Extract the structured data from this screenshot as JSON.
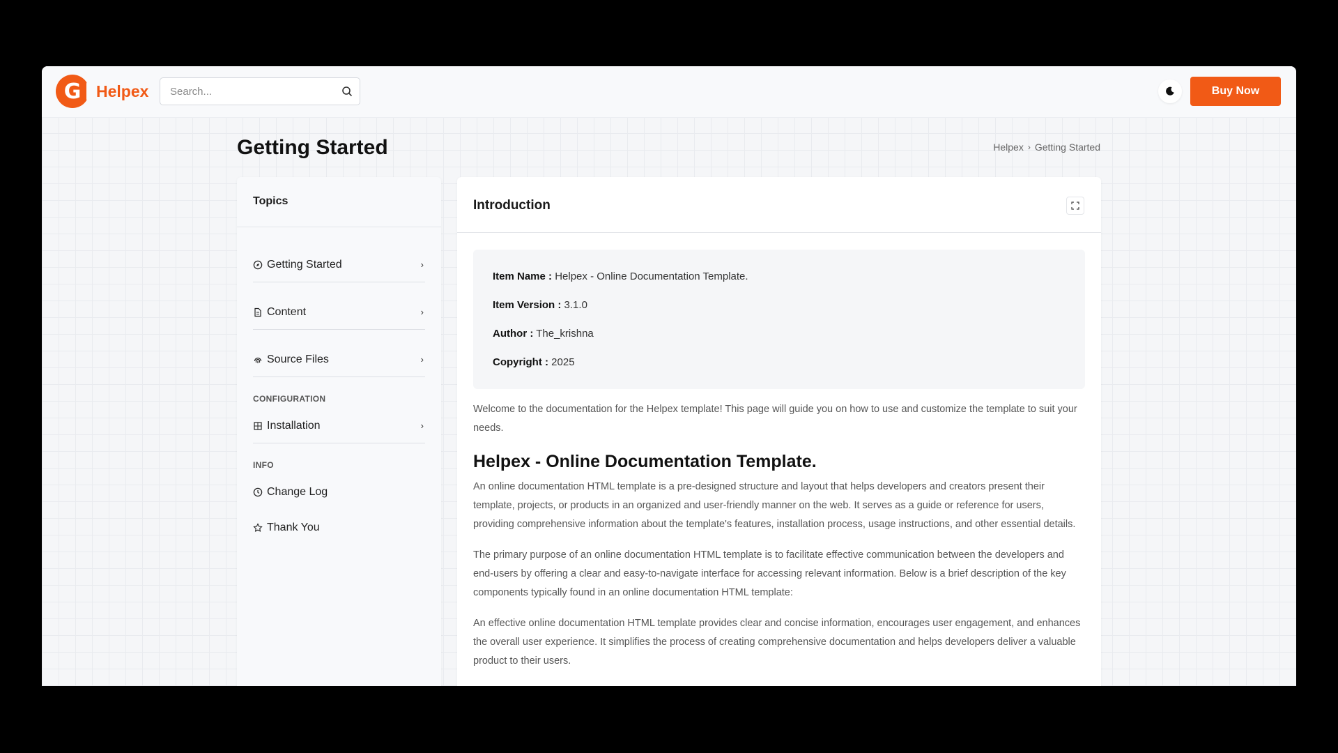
{
  "header": {
    "brand": "Helpex",
    "logo_letter": "G",
    "search_placeholder": "Search...",
    "buy_label": "Buy Now",
    "accent": "#f15a16"
  },
  "page": {
    "title": "Getting Started",
    "breadcrumb": [
      "Helpex",
      "Getting Started"
    ]
  },
  "sidebar": {
    "heading": "Topics",
    "items": [
      {
        "label": "Getting Started",
        "icon": "compass-icon"
      },
      {
        "label": "Content",
        "icon": "document-icon"
      },
      {
        "label": "Source Files",
        "icon": "fingerprint-icon"
      }
    ],
    "section_config": "CONFIGURATION",
    "config_items": [
      {
        "label": "Installation",
        "icon": "grid-icon"
      }
    ],
    "section_info": "INFO",
    "info_items": [
      {
        "label": "Change Log",
        "icon": "clock-icon"
      },
      {
        "label": "Thank You",
        "icon": "star-icon"
      }
    ]
  },
  "content": {
    "heading": "Introduction",
    "info": {
      "item_name_label": "Item Name :",
      "item_name_value": "Helpex - Online Documentation Template.",
      "item_version_label": "Item Version :",
      "item_version_value": "3.1.0",
      "author_label": "Author :",
      "author_value": "The_krishna",
      "copyright_label": "Copyright :",
      "copyright_value": "2025"
    },
    "welcome": "Welcome to the documentation for the Helpex template! This page will guide you on how to use and customize the template to suit your needs.",
    "h2": "Helpex - Online Documentation Template.",
    "paragraphs": [
      "An online documentation HTML template is a pre-designed structure and layout that helps developers and creators present their template, projects, or products in an organized and user-friendly manner on the web. It serves as a guide or reference for users, providing comprehensive information about the template's features, installation process, usage instructions, and other essential details.",
      "The primary purpose of an online documentation HTML template is to facilitate effective communication between the developers and end-users by offering a clear and easy-to-navigate interface for accessing relevant information. Below is a brief description of the key components typically found in an online documentation HTML template:",
      "An effective online documentation HTML template provides clear and concise information, encourages user engagement, and enhances the overall user experience. It simplifies the process of creating comprehensive documentation and helps developers deliver a valuable product to their users."
    ]
  }
}
